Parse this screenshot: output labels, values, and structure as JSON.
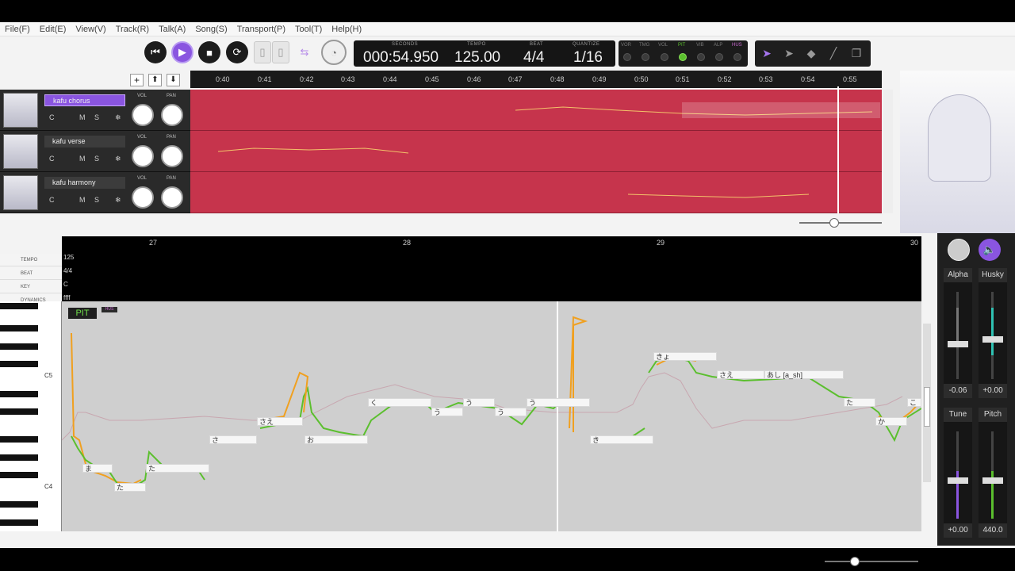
{
  "menu": [
    "File(F)",
    "Edit(E)",
    "View(V)",
    "Track(R)",
    "Talk(A)",
    "Song(S)",
    "Transport(P)",
    "Tool(T)",
    "Help(H)"
  ],
  "transport": {
    "seconds_label": "SECONDS",
    "seconds": "000:54.950",
    "tempo_label": "TEMPO",
    "tempo": "125.00",
    "beat_label": "BEAT",
    "beat": "4/4",
    "quantize_label": "QUANTIZE",
    "quantize": "1/16"
  },
  "params": [
    "VOR",
    "TMG",
    "VOL",
    "PIT",
    "VIB",
    "ALP",
    "HUS"
  ],
  "timeline": [
    "0:40",
    "0:41",
    "0:42",
    "0:43",
    "0:44",
    "0:45",
    "0:46",
    "0:47",
    "0:48",
    "0:49",
    "0:50",
    "0:51",
    "0:52",
    "0:53",
    "0:54",
    "0:55"
  ],
  "tracks": [
    {
      "name": "kafu chorus",
      "selected": true
    },
    {
      "name": "kafu verse",
      "selected": false
    },
    {
      "name": "kafu harmony",
      "selected": false
    }
  ],
  "track_buttons": {
    "c": "C",
    "m": "M",
    "s": "S",
    "vol": "VOL",
    "pan": "PAN"
  },
  "measures": [
    "27",
    "28",
    "29",
    "30"
  ],
  "props": [
    {
      "label": "TEMPO",
      "value": "125"
    },
    {
      "label": "BEAT",
      "value": "4/4"
    },
    {
      "label": "KEY",
      "value": "C"
    },
    {
      "label": "DYNAMICS",
      "value": "ffff"
    }
  ],
  "pit_badge": "PIT",
  "hus_badge": "HUS",
  "key_labels": [
    "C5",
    "C4"
  ],
  "notes": [
    "ま",
    "た",
    "た",
    "さ",
    "さえ",
    "お",
    "く",
    "う",
    "う",
    "う",
    "う",
    "き",
    "きょ",
    "さえ",
    "あし [a_sh]",
    "た",
    "か",
    "こ"
  ],
  "mixer": {
    "alpha": "Alpha",
    "alpha_value": "-0.06",
    "husky": "Husky",
    "husky_value": "+0.00",
    "tune": "Tune",
    "tune_value": "+0.00",
    "pitch": "Pitch",
    "pitch_value": "440.0"
  },
  "colors": {
    "accent": "#8a55e0",
    "lane": "#c6344c",
    "pitch_green": "#5bbf2e",
    "pitch_orange": "#f0a020"
  }
}
